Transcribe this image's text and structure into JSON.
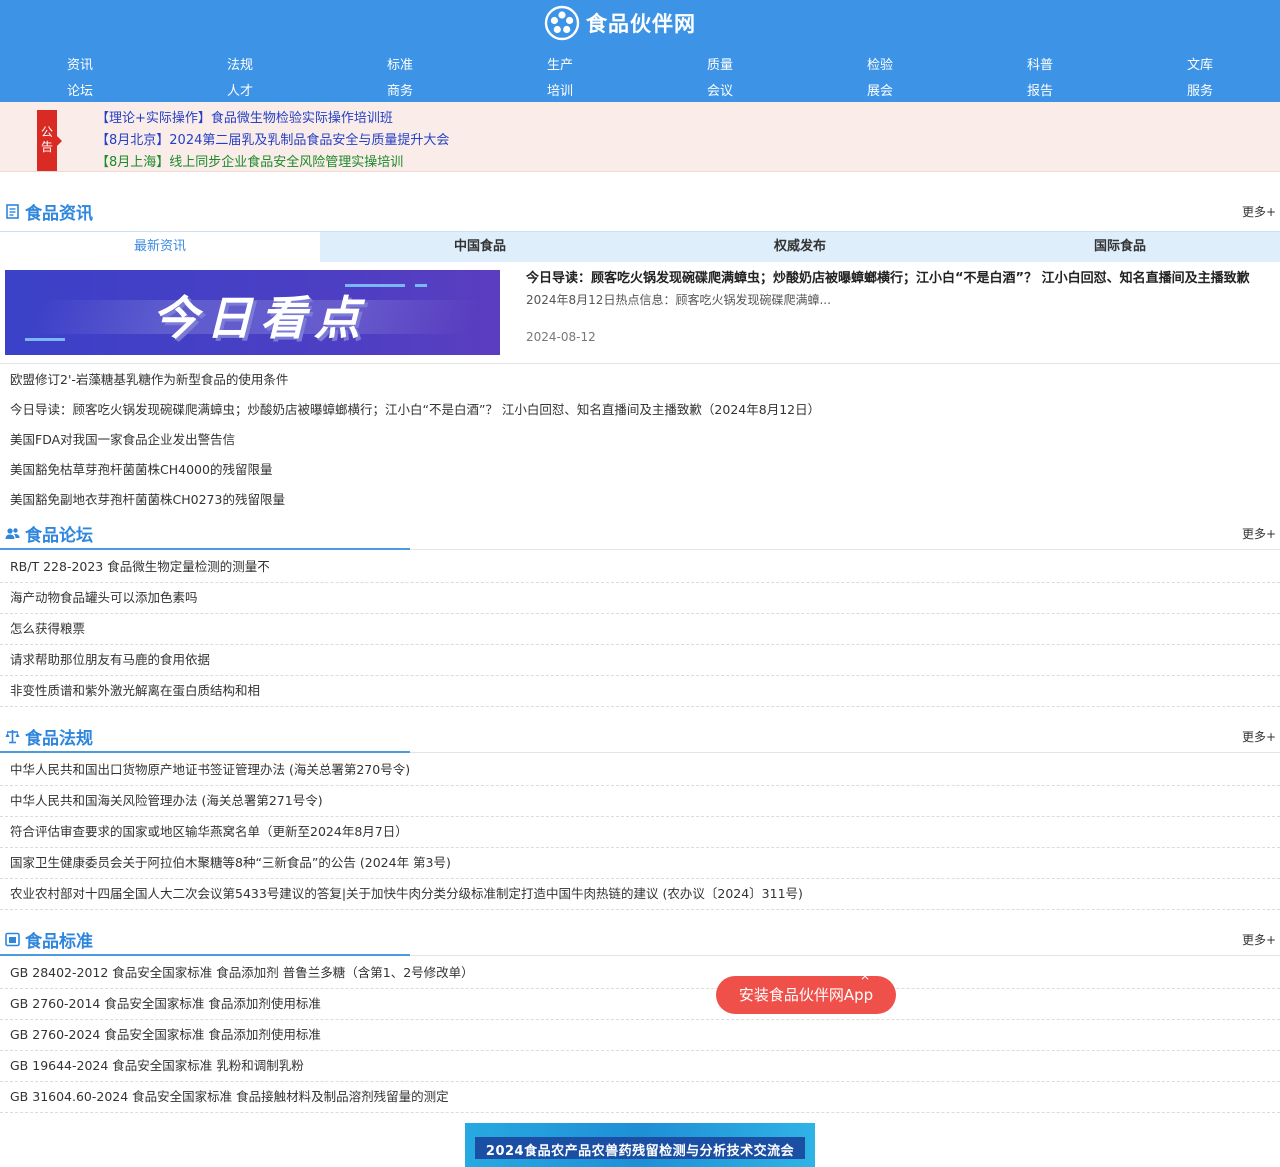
{
  "header": {
    "logo_text": "食品伙伴网",
    "nav_row1": [
      "资讯",
      "法规",
      "标准",
      "生产",
      "质量",
      "检验",
      "科普",
      "文库"
    ],
    "nav_row2": [
      "论坛",
      "人才",
      "商务",
      "培训",
      "会议",
      "展会",
      "报告",
      "服务"
    ]
  },
  "notice": {
    "badge": "公告",
    "items": [
      "【理论+实际操作】食品微生物检验实际操作培训班",
      "【8月北京】2024第二届乳及乳制品食品安全与质量提升大会",
      "【8月上海】线上同步企业食品安全风险管理实操培训"
    ]
  },
  "news": {
    "title": "食品资讯",
    "more": "更多+",
    "tabs": [
      "最新资讯",
      "中国食品",
      "权威发布",
      "国际食品"
    ],
    "featured": {
      "image_text": "今日看点",
      "title": "今日导读：顾客吃火锅发现碗碟爬满蟑虫；炒酸奶店被曝蟑螂横行；江小白“不是白酒”？ 江小白回怼、知名直播间及主播致歉",
      "desc": "2024年8月12日热点信息：顾客吃火锅发现碗碟爬满蟑...",
      "date": "2024-08-12"
    },
    "items": [
      "欧盟修订2'-岩藻糖基乳糖作为新型食品的使用条件",
      "今日导读：顾客吃火锅发现碗碟爬满蟑虫；炒酸奶店被曝蟑螂横行；江小白“不是白酒”？ 江小白回怼、知名直播间及主播致歉（2024年8月12日）",
      "美国FDA对我国一家食品企业发出警告信",
      "美国豁免枯草芽孢杆菌菌株CH4000的残留限量",
      "美国豁免副地衣芽孢杆菌菌株CH0273的残留限量"
    ]
  },
  "forum": {
    "title": "食品论坛",
    "more": "更多+",
    "items": [
      "RB/T 228-2023 食品微生物定量检测的测量不",
      "海产动物食品罐头可以添加色素吗",
      "怎么获得粮票",
      "请求帮助那位朋友有马鹿的食用依据",
      "非变性质谱和紫外激光解离在蛋白质结构和相"
    ]
  },
  "regulations": {
    "title": "食品法规",
    "more": "更多+",
    "items": [
      "中华人民共和国出口货物原产地证书签证管理办法 (海关总署第270号令)",
      "中华人民共和国海关风险管理办法 (海关总署第271号令)",
      "符合评估审查要求的国家或地区输华燕窝名单（更新至2024年8月7日）",
      "国家卫生健康委员会关于阿拉伯木聚糖等8种“三新食品”的公告 (2024年 第3号)",
      "农业农村部对十四届全国人大二次会议第5433号建议的答复|关于加快牛肉分类分级标准制定打造中国牛肉热链的建议 (农办议〔2024〕311号)"
    ]
  },
  "standards": {
    "title": "食品标准",
    "more": "更多+",
    "items": [
      "GB 28402-2012 食品安全国家标准 食品添加剂 普鲁兰多糖（含第1、2号修改单）",
      "GB 2760-2014 食品安全国家标准 食品添加剂使用标准",
      "GB 2760-2024 食品安全国家标准 食品添加剂使用标准",
      "GB 19644-2024 食品安全国家标准 乳粉和调制乳粉",
      "GB 31604.60-2024 食品安全国家标准 食品接触材料及制品溶剂残留量的测定"
    ]
  },
  "app_prompt": {
    "label": "安装食品伙伴网App",
    "close": "×"
  },
  "banner": {
    "text": "2024食品农产品农兽药残留检测与分析技术交流会"
  },
  "colors": {
    "header_bg": "#3d94e6",
    "accent": "#2e86de",
    "notice_bg": "#f9ece9",
    "badge_red": "#d92b23",
    "app_pill": "#f0504a"
  }
}
